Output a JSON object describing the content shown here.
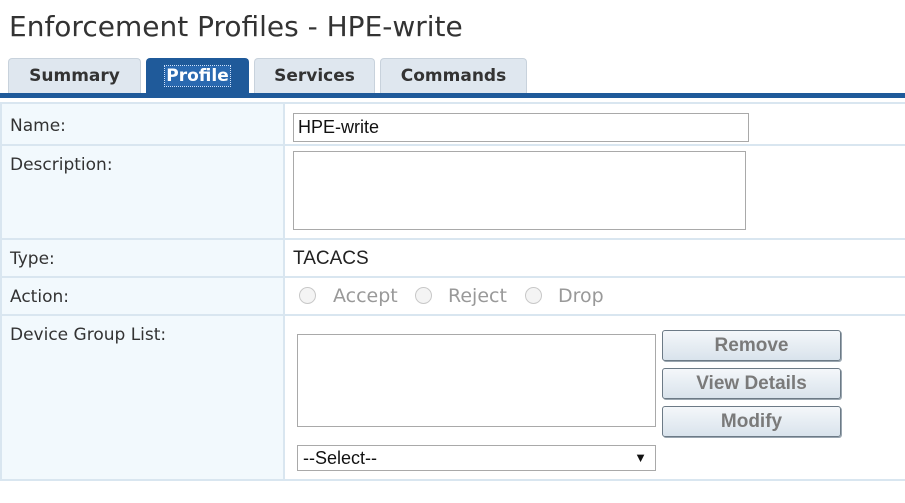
{
  "page": {
    "title": "Enforcement Profiles - HPE-write"
  },
  "tabs": [
    {
      "label": "Summary",
      "active": false
    },
    {
      "label": "Profile",
      "active": true
    },
    {
      "label": "Services",
      "active": false
    },
    {
      "label": "Commands",
      "active": false
    }
  ],
  "form": {
    "name": {
      "label": "Name:",
      "value": "HPE-write"
    },
    "description": {
      "label": "Description:",
      "value": ""
    },
    "type": {
      "label": "Type:",
      "value": "TACACS"
    },
    "action": {
      "label": "Action:",
      "options": [
        "Accept",
        "Reject",
        "Drop"
      ],
      "enabled": false
    },
    "device_group_list": {
      "label": "Device Group List:",
      "items": [],
      "select_value": "--Select--",
      "buttons": {
        "remove": "Remove",
        "view_details": "View Details",
        "modify": "Modify"
      }
    }
  },
  "colors": {
    "accent": "#1f5a9a",
    "tab_inactive": "#dfe7ef",
    "label_bg": "#f2f9fd",
    "row_border": "#d9e6f0"
  }
}
